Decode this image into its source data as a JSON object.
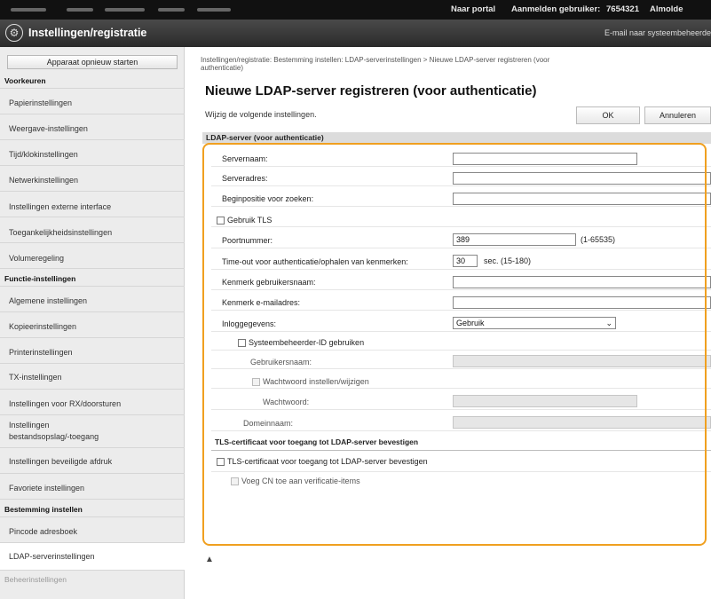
{
  "topbar": {
    "portal_link": "Naar portal",
    "login_text": "Aanmelden gebruiker:",
    "user_id": "7654321",
    "user_name": "Almolde"
  },
  "header": {
    "title": "Instellingen/registratie",
    "mail_link": "E-mail naar systeembeheerde"
  },
  "sidebar": {
    "restart_button": "Apparaat opnieuw starten",
    "group_voorkeuren": "Voorkeuren",
    "group_functie": "Functie-instellingen",
    "group_bestemming": "Bestemming instellen",
    "group_beheer": "Beheerinstellingen",
    "items": [
      "Papierinstellingen",
      "Weergave-instellingen",
      "Tijd/klokinstellingen",
      "Netwerkinstellingen",
      "Instellingen externe interface",
      "Toegankelijkheidsinstellingen",
      "Volumeregeling",
      "Algemene instellingen",
      "Kopieerinstellingen",
      "Printerinstellingen",
      "TX-instellingen",
      "Instellingen voor RX/doorsturen",
      "Instellingen",
      "bestandsopslag/-toegang",
      "Instellingen beveiligde afdruk",
      "Favoriete instellingen",
      "Pincode adresboek",
      "LDAP-serverinstellingen"
    ]
  },
  "main": {
    "breadcrumb_line1": "Instellingen/registratie: Bestemming instellen: LDAP-serverinstellingen > Nieuwe LDAP-server registreren (voor",
    "breadcrumb_line2": "authenticatie)",
    "page_title": "Nieuwe LDAP-server registreren (voor authenticatie)",
    "instruction": "Wijzig de volgende instellingen.",
    "ok_button": "OK",
    "cancel_button": "Annuleren",
    "section_ldap": "LDAP-server (voor authenticatie)",
    "fields": {
      "server_name_label": "Servernaam:",
      "server_name_value": "",
      "server_address_label": "Serveradres:",
      "server_address_value": "",
      "search_start_label": "Beginpositie voor zoeken:",
      "search_start_value": "",
      "use_tls_label": "Gebruik TLS",
      "port_label": "Poortnummer:",
      "port_value": "389",
      "port_hint": "(1-65535)",
      "timeout_label": "Time-out voor authenticatie/ophalen van kenmerken:",
      "timeout_value": "30",
      "timeout_hint": "sec. (15-180)",
      "attr_username_label": "Kenmerk gebruikersnaam:",
      "attr_username_value": "",
      "attr_email_label": "Kenmerk e-mailadres:",
      "attr_email_value": "",
      "login_info_label": "Inloggegevens:",
      "login_info_value": "Gebruik",
      "use_admin_id_label": "Systeembeheerder-ID gebruiken",
      "username_label": "Gebruikersnaam:",
      "set_password_label": "Wachtwoord instellen/wijzigen",
      "password_label": "Wachtwoord:",
      "domain_label": "Domeinnaam:"
    },
    "section_tls": "TLS-certificaat voor toegang tot LDAP-server bevestigen",
    "tls_confirm_label": "TLS-certificaat voor toegang tot LDAP-server bevestigen",
    "add_cn_label": "Voeg CN toe aan verificatie-items",
    "to_top": "▲"
  }
}
